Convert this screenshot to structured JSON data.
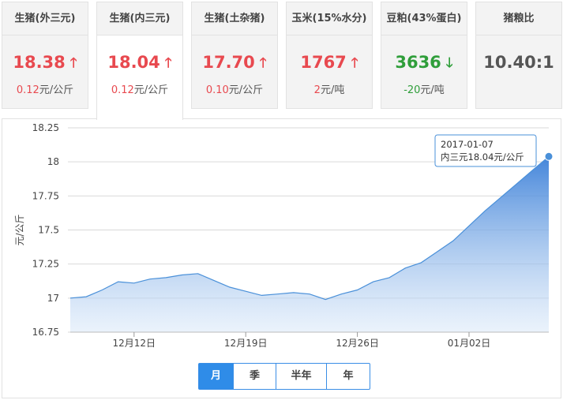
{
  "cards": [
    {
      "title": "生猪(外三元)",
      "price": "18.38",
      "change_value": "0.12",
      "change_unit": "元/公斤",
      "trend": "up",
      "active": false
    },
    {
      "title": "生猪(内三元)",
      "price": "18.04",
      "change_value": "0.12",
      "change_unit": "元/公斤",
      "trend": "up",
      "active": true
    },
    {
      "title": "生猪(土杂猪)",
      "price": "17.70",
      "change_value": "0.10",
      "change_unit": "元/公斤",
      "trend": "up",
      "active": false
    },
    {
      "title": "玉米(15%水分)",
      "price": "1767",
      "change_value": "2",
      "change_unit": "元/吨",
      "trend": "up",
      "active": false
    },
    {
      "title": "豆粕(43%蛋白)",
      "price": "3636",
      "change_value": "-20",
      "change_unit": "元/吨",
      "trend": "down",
      "active": false
    },
    {
      "title": "猪粮比",
      "price": "10.40:1",
      "change_value": "",
      "change_unit": "",
      "trend": "none",
      "active": false
    }
  ],
  "icons": {
    "up": "arrow-up-icon",
    "down": "arrow-down-icon"
  },
  "colors": {
    "up": "#e8494f",
    "down": "#2f9e3a",
    "accent": "#2f8ce8",
    "line": "#4a90d9"
  },
  "range_buttons": [
    {
      "label": "月",
      "active": true
    },
    {
      "label": "季",
      "active": false
    },
    {
      "label": "半年",
      "active": false
    },
    {
      "label": "年",
      "active": false
    }
  ],
  "tooltip": {
    "date": "2017-01-07",
    "text": "内三元18.04元/公斤"
  },
  "chart_data": {
    "type": "area",
    "title": "",
    "xlabel": "",
    "ylabel": "元/公斤",
    "ylim": [
      16.75,
      18.25
    ],
    "yticks": [
      "16.75",
      "17",
      "17.25",
      "17.5",
      "17.75",
      "18",
      "18.25"
    ],
    "xticks": [
      {
        "label": "12月12日",
        "date": "2016-12-12"
      },
      {
        "label": "12月19日",
        "date": "2016-12-19"
      },
      {
        "label": "12月26日",
        "date": "2016-12-26"
      },
      {
        "label": "01月02日",
        "date": "2017-01-02"
      }
    ],
    "grid": true,
    "legend": "none",
    "series": [
      {
        "x": [
          "2016-12-08",
          "2016-12-09",
          "2016-12-10",
          "2016-12-11",
          "2016-12-12",
          "2016-12-13",
          "2016-12-14",
          "2016-12-15",
          "2016-12-16",
          "2016-12-17",
          "2016-12-18",
          "2016-12-19",
          "2016-12-20",
          "2016-12-21",
          "2016-12-22",
          "2016-12-23",
          "2016-12-24",
          "2016-12-25",
          "2016-12-26",
          "2016-12-27",
          "2016-12-28",
          "2016-12-29",
          "2016-12-30",
          "2016-12-31",
          "2017-01-01",
          "2017-01-02",
          "2017-01-03",
          "2017-01-04",
          "2017-01-05",
          "2017-01-06",
          "2017-01-07"
        ],
        "values": [
          17.0,
          17.01,
          17.06,
          17.12,
          17.11,
          17.14,
          17.15,
          17.17,
          17.18,
          17.13,
          17.08,
          17.05,
          17.02,
          17.03,
          17.04,
          17.03,
          16.99,
          17.03,
          17.06,
          17.12,
          17.15,
          17.22,
          17.26,
          17.34,
          17.42,
          17.53,
          17.64,
          17.74,
          17.84,
          17.94,
          18.04
        ]
      }
    ]
  }
}
